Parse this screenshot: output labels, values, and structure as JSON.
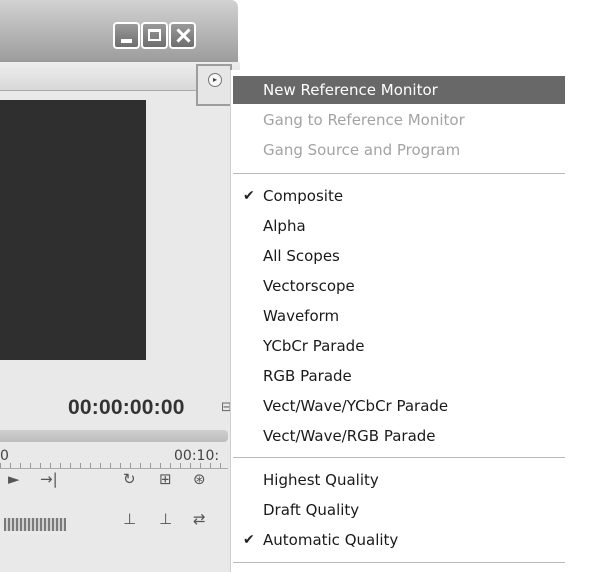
{
  "monitor": {
    "timecode": "00:00:00:00",
    "ruler_start": "0",
    "ruler_end": "00:10:",
    "flyout_glyph": "▸"
  },
  "icons": {
    "min": "minimize-icon",
    "max": "maximize-icon",
    "close": "close-icon",
    "check": "✔"
  },
  "menu": {
    "group1": [
      {
        "label": "New Reference Monitor",
        "state": "highlighted"
      },
      {
        "label": "Gang to Reference Monitor",
        "state": "disabled"
      },
      {
        "label": "Gang Source and Program",
        "state": "disabled"
      }
    ],
    "group2": [
      {
        "label": "Composite",
        "checked": true
      },
      {
        "label": "Alpha",
        "checked": false
      },
      {
        "label": "All Scopes",
        "checked": false
      },
      {
        "label": "Vectorscope",
        "checked": false
      },
      {
        "label": "Waveform",
        "checked": false
      },
      {
        "label": "YCbCr Parade",
        "checked": false
      },
      {
        "label": "RGB Parade",
        "checked": false
      },
      {
        "label": "Vect/Wave/YCbCr Parade",
        "checked": false
      },
      {
        "label": "Vect/Wave/RGB Parade",
        "checked": false
      }
    ],
    "group3": [
      {
        "label": "Highest Quality",
        "checked": false
      },
      {
        "label": "Draft Quality",
        "checked": false
      },
      {
        "label": "Automatic Quality",
        "checked": true
      }
    ]
  },
  "colors": {
    "highlight": "#686868",
    "disabled_text": "#a3a3a3"
  }
}
